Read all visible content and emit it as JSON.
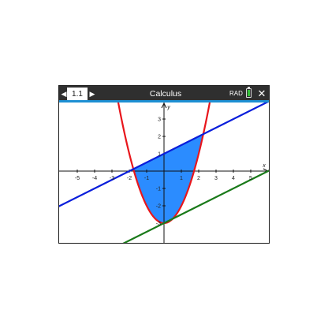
{
  "titlebar": {
    "tab_label": "1.1",
    "doc_title": "Calculus",
    "angle_mode": "RAD",
    "close_glyph": "✕",
    "left_arrow_glyph": "◀",
    "right_arrow_glyph": "▶",
    "icons": [
      "arrow-left-icon",
      "arrow-right-icon",
      "battery-icon",
      "close-icon"
    ]
  },
  "colors": {
    "parabola": "#e8161c",
    "blue_line": "#0a1edb",
    "green_line": "#1a7a1a",
    "shaded_region": "#2b8cff",
    "tab_accent": "#1d8fd3",
    "battery_level": "#35c23a"
  },
  "chart_data": {
    "type": "line",
    "xlabel": "x",
    "ylabel": "y",
    "xlim": [
      -6,
      6
    ],
    "ylim": [
      -4,
      4
    ],
    "grid": false,
    "x_ticks": [
      -5,
      -4,
      -3,
      -2,
      -1,
      1,
      2,
      3,
      4,
      5
    ],
    "x_tick_labels": [
      "-5",
      "-4",
      "-3",
      "-2",
      "-1",
      "1",
      "2",
      "3",
      "4",
      "5"
    ],
    "y_ticks": [
      -3,
      -2,
      -1,
      1,
      2,
      3
    ],
    "y_tick_labels": [
      "-3",
      "-2",
      "-1",
      "1",
      "2",
      "3"
    ],
    "series": [
      {
        "kind": "function",
        "expr": "x^2 - 3",
        "color": "#e8161c"
      },
      {
        "kind": "function",
        "expr": "0.5x + 1",
        "color": "#0a1edb"
      },
      {
        "kind": "function",
        "expr": "0.5x - 3",
        "color": "#1a7a1a"
      }
    ],
    "shaded_region": {
      "between": [
        "x^2 - 3",
        "0.5x + 1"
      ],
      "x_from": -1.77,
      "x_to": 2.27,
      "color": "#2b8cff"
    }
  }
}
